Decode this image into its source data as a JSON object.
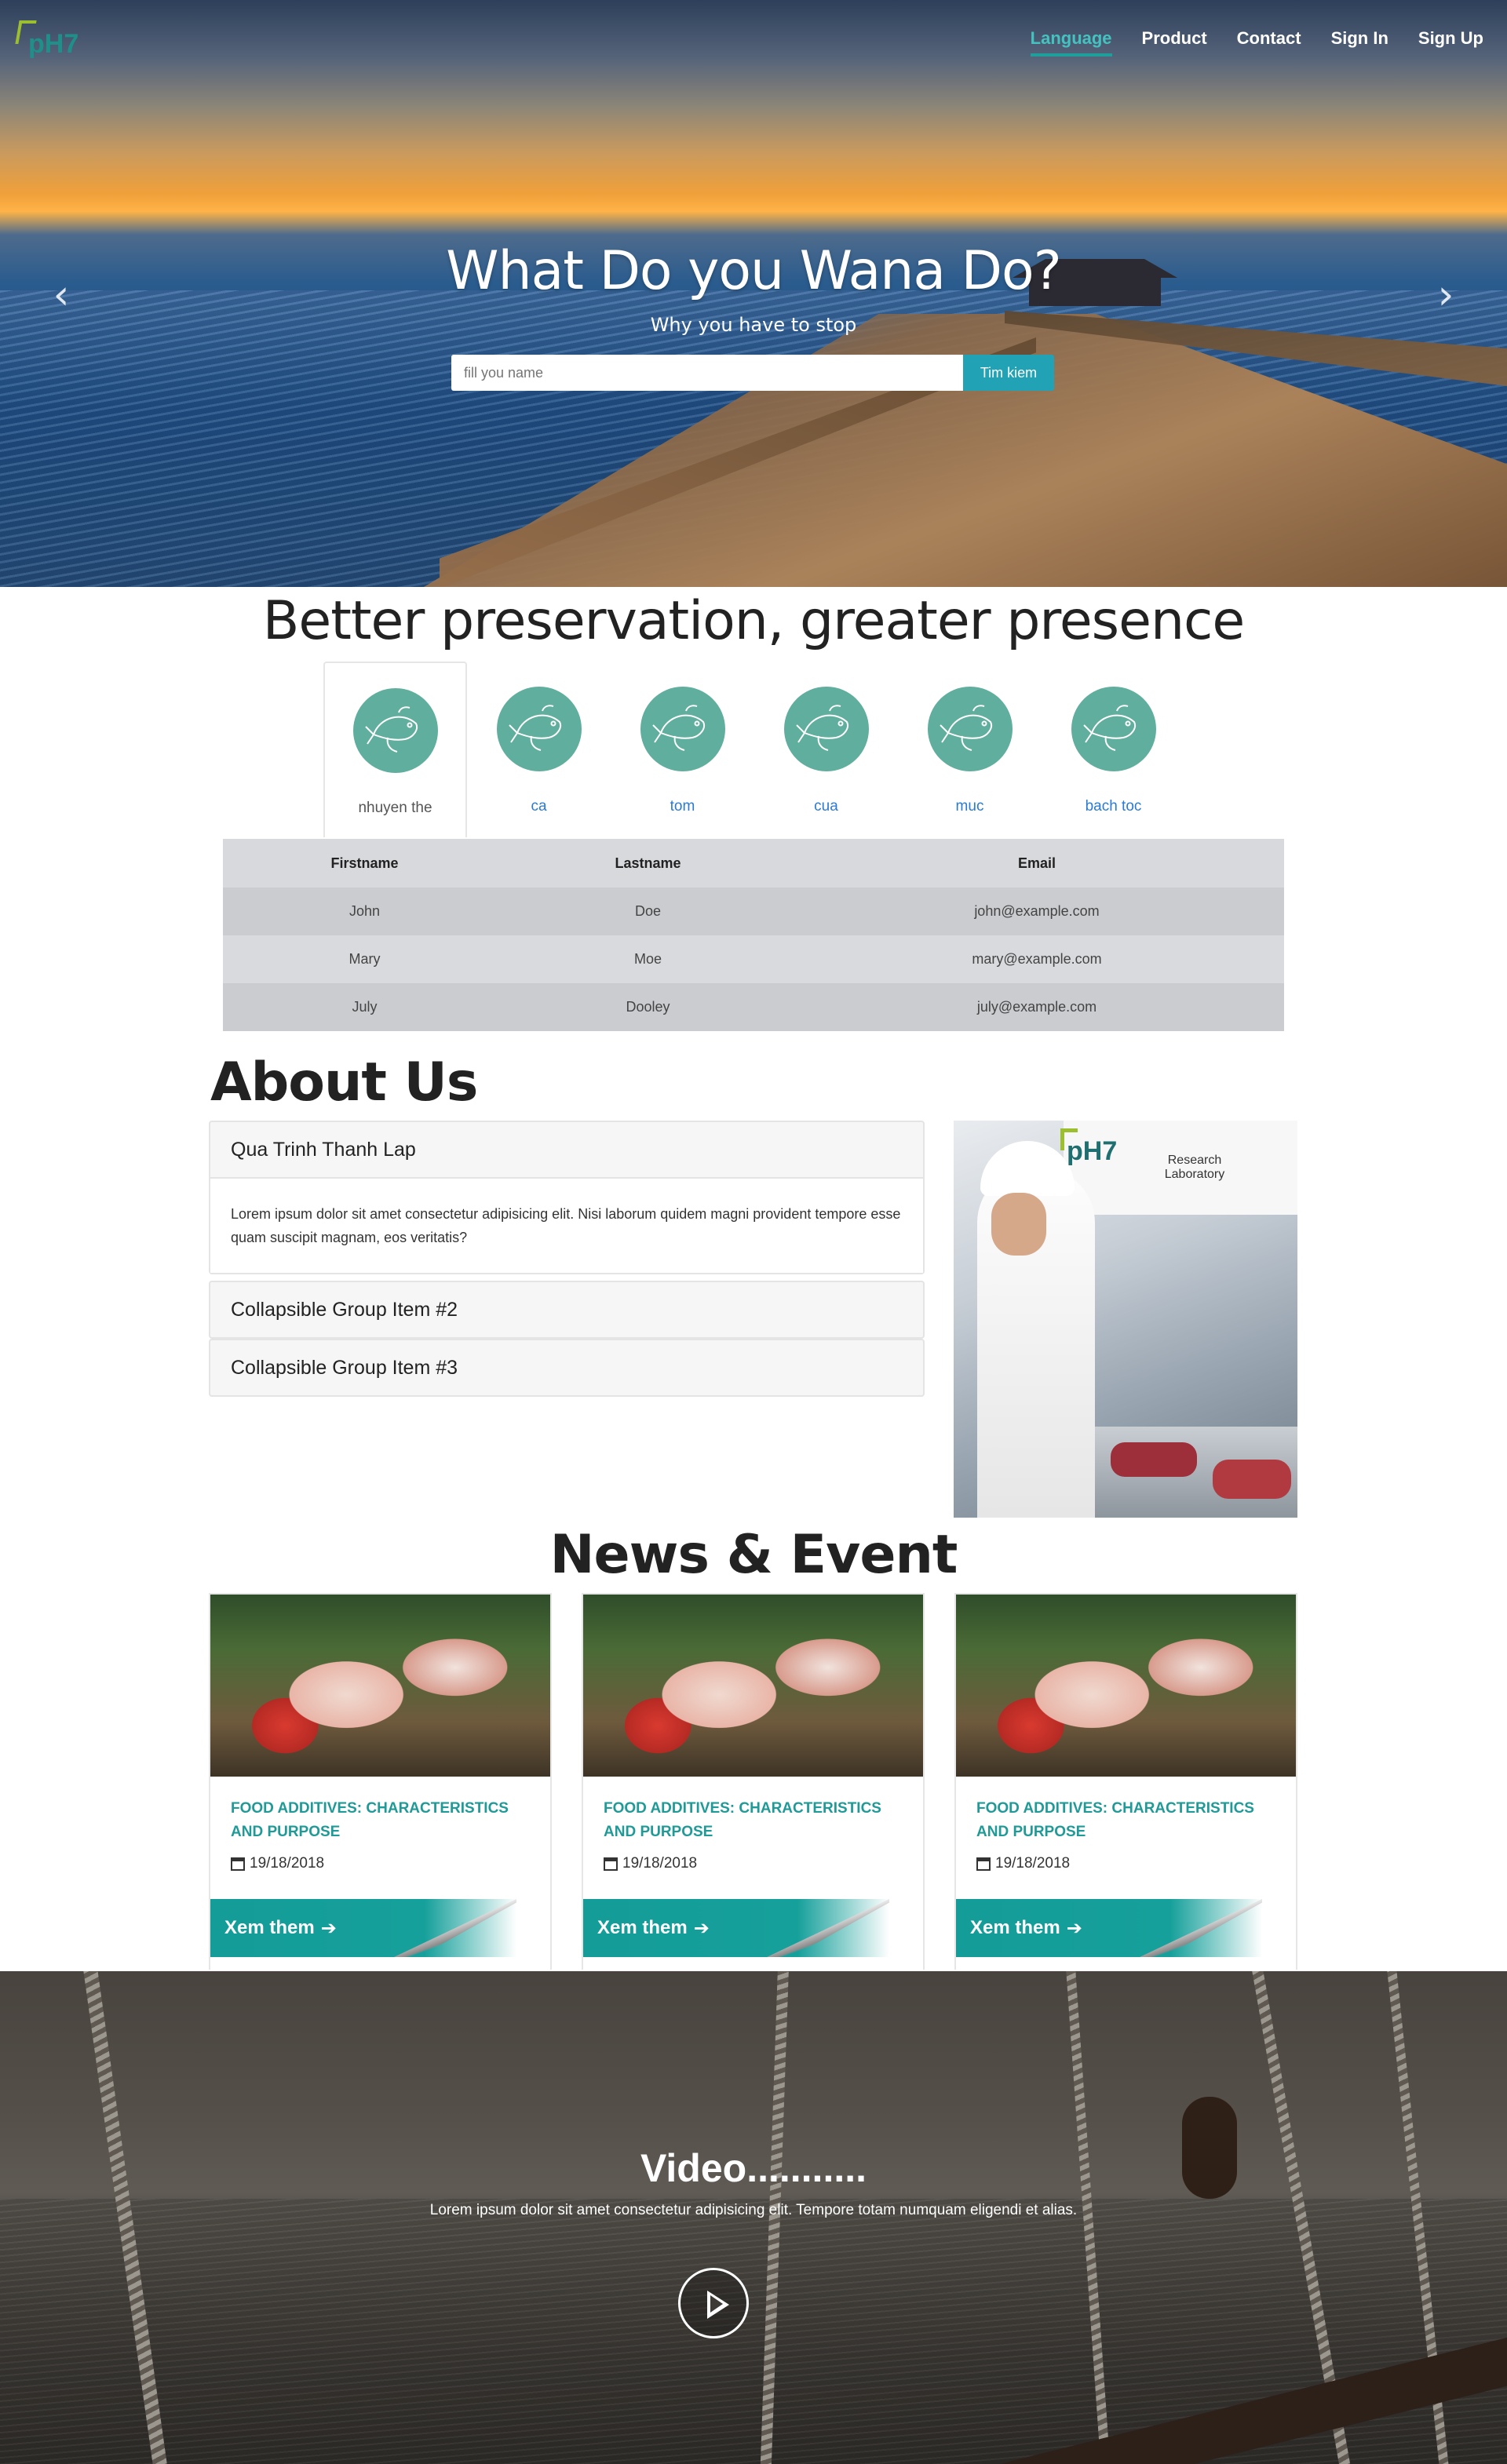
{
  "header": {
    "logo_text": "pH7",
    "nav": [
      {
        "label": "Language",
        "active": true
      },
      {
        "label": "Product",
        "active": false
      },
      {
        "label": "Contact",
        "active": false
      },
      {
        "label": "Sign In",
        "active": false
      },
      {
        "label": "Sign Up",
        "active": false
      }
    ]
  },
  "hero": {
    "title": "What Do you Wana Do?",
    "subtitle": "Why you have to stop",
    "search_placeholder": "fill you name",
    "search_button": "Tim kiem",
    "prev_icon": "chevron-left-icon",
    "next_icon": "chevron-right-icon"
  },
  "preservation": {
    "title": "Better preservation, greater presence",
    "tabs": [
      {
        "label": "nhuyen the",
        "icon": "fish-icon",
        "active": true
      },
      {
        "label": "ca",
        "icon": "fish-icon",
        "active": false
      },
      {
        "label": "tom",
        "icon": "fish-icon",
        "active": false
      },
      {
        "label": "cua",
        "icon": "fish-icon",
        "active": false
      },
      {
        "label": "muc",
        "icon": "fish-icon",
        "active": false
      },
      {
        "label": "bach toc",
        "icon": "fish-icon",
        "active": false
      }
    ],
    "table": {
      "headers": [
        "Firstname",
        "Lastname",
        "Email"
      ],
      "rows": [
        [
          "John",
          "Doe",
          "john@example.com"
        ],
        [
          "Mary",
          "Moe",
          "mary@example.com"
        ],
        [
          "July",
          "Dooley",
          "july@example.com"
        ]
      ]
    }
  },
  "about": {
    "title": "About Us",
    "items": [
      {
        "title": "Qua Trinh Thanh Lap",
        "body": "Lorem ipsum dolor sit amet consectetur adipisicing elit. Nisi laborum quidem magni provident tempore esse quam suscipit magnam, eos veritatis?",
        "open": true
      },
      {
        "title": "Collapsible Group Item #2",
        "open": false
      },
      {
        "title": "Collapsible Group Item #3",
        "open": false
      }
    ],
    "image": {
      "logo": "pH7",
      "caption": "Research Laboratory"
    }
  },
  "news": {
    "title": "News & Event",
    "cards": [
      {
        "title": "FOOD ADDITIVES: CHARACTERISTICS AND PURPOSE",
        "date": "19/18/2018",
        "more": "Xem them"
      },
      {
        "title": "FOOD ADDITIVES: CHARACTERISTICS AND PURPOSE",
        "date": "19/18/2018",
        "more": "Xem them"
      },
      {
        "title": "FOOD ADDITIVES: CHARACTERISTICS AND PURPOSE",
        "date": "19/18/2018",
        "more": "Xem them"
      }
    ]
  },
  "video": {
    "title": "Video...........",
    "text": "Lorem ipsum dolor sit amet consectetur adipisicing elit. Tempore totam numquam eligendi et alias.",
    "play_icon": "play-icon"
  },
  "colors": {
    "accent": "#1f9a96",
    "link": "#2b7bd4",
    "search_button": "#21a3b5",
    "icon_circle": "#5fae9e"
  }
}
